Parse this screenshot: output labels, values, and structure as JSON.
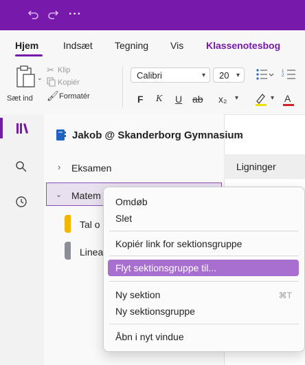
{
  "titlebar": {
    "undo_icon": "undo-icon",
    "redo_icon": "redo-icon",
    "more_label": "···"
  },
  "menu": {
    "tabs": [
      {
        "label": "Hjem",
        "active": true
      },
      {
        "label": "Indsæt"
      },
      {
        "label": "Tegning"
      },
      {
        "label": "Vis"
      },
      {
        "label": "Klassenotesbog",
        "accent": true
      }
    ]
  },
  "ribbon": {
    "paste_label": "Sæt ind",
    "cut_label": "Klip",
    "copy_label": "Kopiér",
    "format_painter_label": "Formatér",
    "font_name": "Calibri",
    "font_size": "20",
    "format_buttons": [
      "F",
      "K",
      "U",
      "ab",
      "x₂"
    ]
  },
  "notebook": {
    "title": "Jakob @ Skanderborg Gymnasium",
    "sections": [
      {
        "label": "Eksamen",
        "expanded": false
      },
      {
        "label": "Matem",
        "expanded": true,
        "selected": true
      },
      {
        "label": "Tal o",
        "color": "#f2b600"
      },
      {
        "label": "Linea",
        "color": "#8a8f96"
      }
    ],
    "page": "Ligninger"
  },
  "context_menu": {
    "items": [
      {
        "label": "Omdøb"
      },
      {
        "label": "Slet"
      },
      {
        "label": "Kopiér link for sektionsgruppe"
      },
      {
        "label": "Flyt sektionsgruppe til...",
        "highlighted": true
      },
      {
        "label": "Ny sektion",
        "shortcut": "⌘T"
      },
      {
        "label": "Ny sektionsgruppe"
      },
      {
        "label": "Åbn i nyt vindue"
      }
    ]
  },
  "colors": {
    "brand": "#7719aa",
    "highlight": "#a86fd0"
  }
}
